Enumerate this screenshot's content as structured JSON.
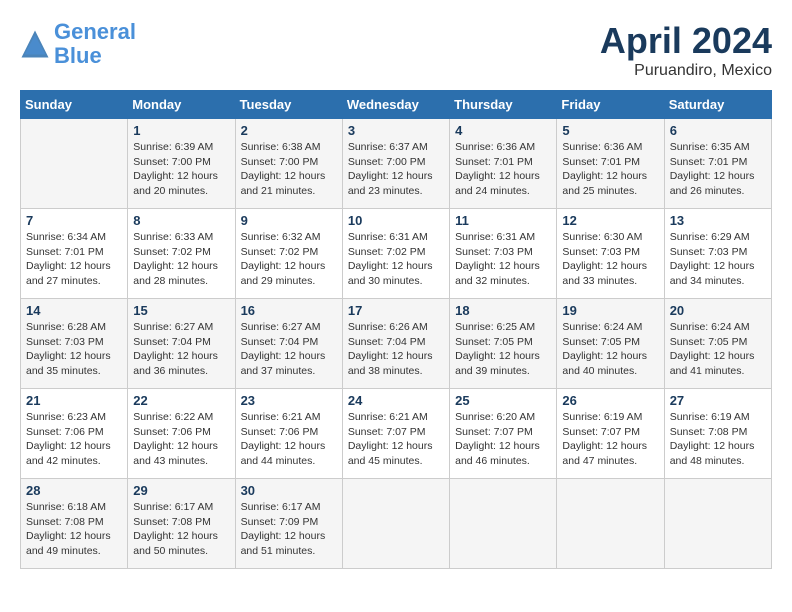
{
  "header": {
    "logo_line1": "General",
    "logo_line2": "Blue",
    "month": "April 2024",
    "location": "Puruandiro, Mexico"
  },
  "weekdays": [
    "Sunday",
    "Monday",
    "Tuesday",
    "Wednesday",
    "Thursday",
    "Friday",
    "Saturday"
  ],
  "weeks": [
    [
      {
        "day": "",
        "sunrise": "",
        "sunset": "",
        "daylight": ""
      },
      {
        "day": "1",
        "sunrise": "Sunrise: 6:39 AM",
        "sunset": "Sunset: 7:00 PM",
        "daylight": "Daylight: 12 hours and 20 minutes."
      },
      {
        "day": "2",
        "sunrise": "Sunrise: 6:38 AM",
        "sunset": "Sunset: 7:00 PM",
        "daylight": "Daylight: 12 hours and 21 minutes."
      },
      {
        "day": "3",
        "sunrise": "Sunrise: 6:37 AM",
        "sunset": "Sunset: 7:00 PM",
        "daylight": "Daylight: 12 hours and 23 minutes."
      },
      {
        "day": "4",
        "sunrise": "Sunrise: 6:36 AM",
        "sunset": "Sunset: 7:01 PM",
        "daylight": "Daylight: 12 hours and 24 minutes."
      },
      {
        "day": "5",
        "sunrise": "Sunrise: 6:36 AM",
        "sunset": "Sunset: 7:01 PM",
        "daylight": "Daylight: 12 hours and 25 minutes."
      },
      {
        "day": "6",
        "sunrise": "Sunrise: 6:35 AM",
        "sunset": "Sunset: 7:01 PM",
        "daylight": "Daylight: 12 hours and 26 minutes."
      }
    ],
    [
      {
        "day": "7",
        "sunrise": "Sunrise: 6:34 AM",
        "sunset": "Sunset: 7:01 PM",
        "daylight": "Daylight: 12 hours and 27 minutes."
      },
      {
        "day": "8",
        "sunrise": "Sunrise: 6:33 AM",
        "sunset": "Sunset: 7:02 PM",
        "daylight": "Daylight: 12 hours and 28 minutes."
      },
      {
        "day": "9",
        "sunrise": "Sunrise: 6:32 AM",
        "sunset": "Sunset: 7:02 PM",
        "daylight": "Daylight: 12 hours and 29 minutes."
      },
      {
        "day": "10",
        "sunrise": "Sunrise: 6:31 AM",
        "sunset": "Sunset: 7:02 PM",
        "daylight": "Daylight: 12 hours and 30 minutes."
      },
      {
        "day": "11",
        "sunrise": "Sunrise: 6:31 AM",
        "sunset": "Sunset: 7:03 PM",
        "daylight": "Daylight: 12 hours and 32 minutes."
      },
      {
        "day": "12",
        "sunrise": "Sunrise: 6:30 AM",
        "sunset": "Sunset: 7:03 PM",
        "daylight": "Daylight: 12 hours and 33 minutes."
      },
      {
        "day": "13",
        "sunrise": "Sunrise: 6:29 AM",
        "sunset": "Sunset: 7:03 PM",
        "daylight": "Daylight: 12 hours and 34 minutes."
      }
    ],
    [
      {
        "day": "14",
        "sunrise": "Sunrise: 6:28 AM",
        "sunset": "Sunset: 7:03 PM",
        "daylight": "Daylight: 12 hours and 35 minutes."
      },
      {
        "day": "15",
        "sunrise": "Sunrise: 6:27 AM",
        "sunset": "Sunset: 7:04 PM",
        "daylight": "Daylight: 12 hours and 36 minutes."
      },
      {
        "day": "16",
        "sunrise": "Sunrise: 6:27 AM",
        "sunset": "Sunset: 7:04 PM",
        "daylight": "Daylight: 12 hours and 37 minutes."
      },
      {
        "day": "17",
        "sunrise": "Sunrise: 6:26 AM",
        "sunset": "Sunset: 7:04 PM",
        "daylight": "Daylight: 12 hours and 38 minutes."
      },
      {
        "day": "18",
        "sunrise": "Sunrise: 6:25 AM",
        "sunset": "Sunset: 7:05 PM",
        "daylight": "Daylight: 12 hours and 39 minutes."
      },
      {
        "day": "19",
        "sunrise": "Sunrise: 6:24 AM",
        "sunset": "Sunset: 7:05 PM",
        "daylight": "Daylight: 12 hours and 40 minutes."
      },
      {
        "day": "20",
        "sunrise": "Sunrise: 6:24 AM",
        "sunset": "Sunset: 7:05 PM",
        "daylight": "Daylight: 12 hours and 41 minutes."
      }
    ],
    [
      {
        "day": "21",
        "sunrise": "Sunrise: 6:23 AM",
        "sunset": "Sunset: 7:06 PM",
        "daylight": "Daylight: 12 hours and 42 minutes."
      },
      {
        "day": "22",
        "sunrise": "Sunrise: 6:22 AM",
        "sunset": "Sunset: 7:06 PM",
        "daylight": "Daylight: 12 hours and 43 minutes."
      },
      {
        "day": "23",
        "sunrise": "Sunrise: 6:21 AM",
        "sunset": "Sunset: 7:06 PM",
        "daylight": "Daylight: 12 hours and 44 minutes."
      },
      {
        "day": "24",
        "sunrise": "Sunrise: 6:21 AM",
        "sunset": "Sunset: 7:07 PM",
        "daylight": "Daylight: 12 hours and 45 minutes."
      },
      {
        "day": "25",
        "sunrise": "Sunrise: 6:20 AM",
        "sunset": "Sunset: 7:07 PM",
        "daylight": "Daylight: 12 hours and 46 minutes."
      },
      {
        "day": "26",
        "sunrise": "Sunrise: 6:19 AM",
        "sunset": "Sunset: 7:07 PM",
        "daylight": "Daylight: 12 hours and 47 minutes."
      },
      {
        "day": "27",
        "sunrise": "Sunrise: 6:19 AM",
        "sunset": "Sunset: 7:08 PM",
        "daylight": "Daylight: 12 hours and 48 minutes."
      }
    ],
    [
      {
        "day": "28",
        "sunrise": "Sunrise: 6:18 AM",
        "sunset": "Sunset: 7:08 PM",
        "daylight": "Daylight: 12 hours and 49 minutes."
      },
      {
        "day": "29",
        "sunrise": "Sunrise: 6:17 AM",
        "sunset": "Sunset: 7:08 PM",
        "daylight": "Daylight: 12 hours and 50 minutes."
      },
      {
        "day": "30",
        "sunrise": "Sunrise: 6:17 AM",
        "sunset": "Sunset: 7:09 PM",
        "daylight": "Daylight: 12 hours and 51 minutes."
      },
      {
        "day": "",
        "sunrise": "",
        "sunset": "",
        "daylight": ""
      },
      {
        "day": "",
        "sunrise": "",
        "sunset": "",
        "daylight": ""
      },
      {
        "day": "",
        "sunrise": "",
        "sunset": "",
        "daylight": ""
      },
      {
        "day": "",
        "sunrise": "",
        "sunset": "",
        "daylight": ""
      }
    ]
  ]
}
